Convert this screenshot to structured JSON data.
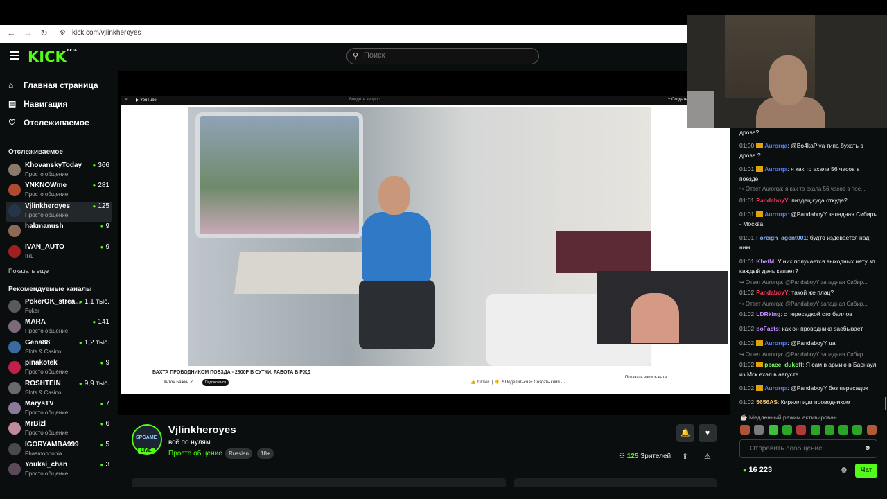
{
  "browser": {
    "url": "kick.com/vjlinkheroyes",
    "back": "←",
    "forward": "→",
    "reload": "↻"
  },
  "header": {
    "logo": "KICK",
    "beta": "BETA",
    "search_placeholder": "Поиск"
  },
  "nav": [
    {
      "icon": "⌂",
      "label": "Главная страница"
    },
    {
      "icon": "▤",
      "label": "Навигация"
    },
    {
      "icon": "♡",
      "label": "Отслеживаемое"
    }
  ],
  "followed": {
    "title": "Отслеживаемое",
    "channels": [
      {
        "name": "KhovanskyToday",
        "category": "Просто общение",
        "viewers": "366",
        "color": "#8a7a6a"
      },
      {
        "name": "YNKNOWme",
        "category": "Просто общение",
        "viewers": "281",
        "color": "#b04a30"
      },
      {
        "name": "Vjlinkheroyes",
        "category": "Просто общение",
        "viewers": "125",
        "color": "#26364a"
      },
      {
        "name": "hakmanush",
        "category": "",
        "viewers": "9",
        "color": "#8c6a55"
      },
      {
        "name": "IVAN_AUTO",
        "category": "IRL",
        "viewers": "9",
        "color": "#a02020"
      }
    ],
    "more": "Показать еще"
  },
  "recommended": {
    "title": "Рекомендуемые каналы",
    "channels": [
      {
        "name": "PokerOK_strea...",
        "category": "Poker",
        "viewers": "1,1 тыс.",
        "color": "#5a5a5a"
      },
      {
        "name": "MARA",
        "category": "Просто общение",
        "viewers": "141",
        "color": "#7a6a7a"
      },
      {
        "name": "Gena88",
        "category": "Slots & Casino",
        "viewers": "1,2 тыс.",
        "color": "#3a6aa0"
      },
      {
        "name": "pinakotek",
        "category": "Просто общение",
        "viewers": "9",
        "color": "#c0204a"
      },
      {
        "name": "ROSHTEIN",
        "category": "Slots & Casino",
        "viewers": "9,9 тыс.",
        "color": "#6a6a6a"
      },
      {
        "name": "MarysTV",
        "category": "Просто общение",
        "viewers": "7",
        "color": "#8a7a9a"
      },
      {
        "name": "MrBizl",
        "category": "Просто общение",
        "viewers": "6",
        "color": "#c08a9a"
      },
      {
        "name": "IGORYAMBA999",
        "category": "Phasmophobia",
        "viewers": "5",
        "color": "#4a4a4a"
      },
      {
        "name": "Youkai_chan",
        "category": "Просто общение",
        "viewers": "3",
        "color": "#5a4a5a"
      }
    ]
  },
  "video": {
    "yt_logo": "▶ YouTube",
    "yt_search": "Введите запрос",
    "yt_create": "+ Создать",
    "title": "ВАХТА ПРОВОДНИКОМ ПОЕЗДА - 2800Р В СУТКИ. РАБОТА В РЖД",
    "author": "Антон Бажин ✓",
    "subscribe": "Подписаться",
    "meta": "👍 19 тыс. | 👎   ↗ Поделиться   ✂ Создать клип   ···",
    "right": "Показать запись чата"
  },
  "channel": {
    "avatar_text": "SPGAME",
    "live": "LIVE",
    "name": "Vjlinkheroyes",
    "title": "всё по нулям",
    "category": "Просто общение",
    "tags": [
      "Russian",
      "18+"
    ],
    "viewers_count": "125",
    "viewers_label": "Зрителей"
  },
  "chat": {
    "messages": [
      {
        "time": "",
        "user": "",
        "color": "#eee",
        "crown": false,
        "text": "дрова?"
      },
      {
        "time": "01:00",
        "user": "Aurorqa",
        "color": "#4c7dff",
        "crown": true,
        "text": ": @Bo4kaPiva типа бухать в дрова ?"
      },
      {
        "time": "01:01",
        "user": "Aurorqa",
        "color": "#4c7dff",
        "crown": true,
        "text": ": я как то ехала 56 часов в поезде"
      },
      {
        "reply": "↪ Ответ Aurorqa: я как то ехала 56 часов в пое..."
      },
      {
        "time": "01:01",
        "user": "PandaboyY",
        "color": "#ff3b5c",
        "crown": false,
        "text": ": пиздец,куда откуда?"
      },
      {
        "time": "01:01",
        "user": "Aurorqa",
        "color": "#4c7dff",
        "crown": true,
        "text": ": @PandaboyY западная Сибирь - Москва"
      },
      {
        "time": "01:01",
        "user": "Foreign_agent001",
        "color": "#86b5ff",
        "crown": false,
        "text": ": будто издевается над ним"
      },
      {
        "time": "01:01",
        "user": "KhetM",
        "color": "#c28dff",
        "crown": false,
        "text": ": У них получается выходных нету зп каждый день капает?"
      },
      {
        "reply": "↪ Ответ Aurorqa: @PandaboyY западная Сибир..."
      },
      {
        "time": "01:02",
        "user": "PandaboyY",
        "color": "#ff3b5c",
        "crown": false,
        "text": ": такой же плац?"
      },
      {
        "reply": "↪ Ответ Aurorqa: @PandaboyY западная Сибир..."
      },
      {
        "time": "01:02",
        "user": "LDRking",
        "color": "#c28dff",
        "crown": false,
        "text": ": с пересадкой сто баллов"
      },
      {
        "time": "01:02",
        "user": "poFacts",
        "color": "#c28dff",
        "crown": false,
        "text": ": как он проводника заебывает"
      },
      {
        "time": "01:02",
        "user": "Aurorqa",
        "color": "#4c7dff",
        "crown": true,
        "text": ": @PandaboyY да"
      },
      {
        "reply": "↪ Ответ Aurorqa: @PandaboyY западная Сибир..."
      },
      {
        "time": "01:02",
        "user": "peace_dukoff",
        "color": "#7cf76a",
        "crown": true,
        "text": ": Я сам в армию в Барнаул из Мск ехал в августе"
      },
      {
        "time": "01:02",
        "user": "Aurorqa",
        "color": "#4c7dff",
        "crown": true,
        "text": ": @PandaboyY без пересадок"
      },
      {
        "time": "01:02",
        "user": "5656AS",
        "color": "#f5c46a",
        "crown": false,
        "text": ": Кирилл иди проводником"
      }
    ],
    "slow_mode": "☕ Медленный режим активирован",
    "input_placeholder": "Отправить сообщение",
    "points": "16 223",
    "send_label": "Чат"
  }
}
